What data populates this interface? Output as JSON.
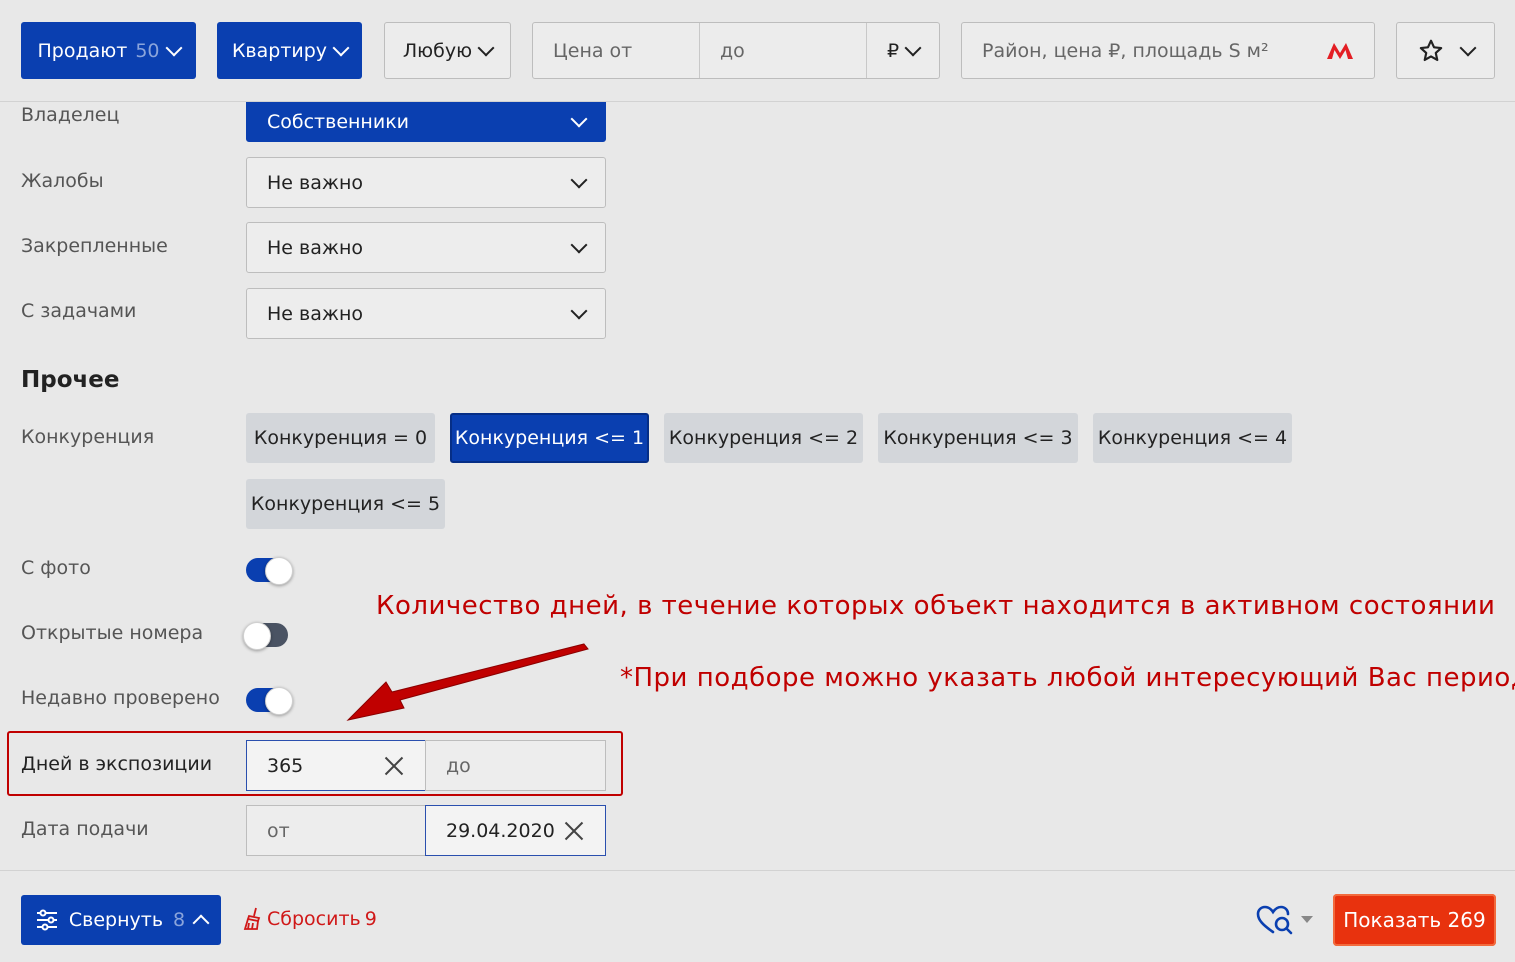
{
  "topbar": {
    "deal": {
      "label": "Продают",
      "count": "50"
    },
    "type": {
      "label": "Квартиру"
    },
    "rooms": {
      "label": "Любую"
    },
    "price": {
      "from_placeholder": "Цена от",
      "to_placeholder": "до",
      "currency": "₽"
    },
    "search": {
      "placeholder": "Район, цена ₽, площадь S м²"
    },
    "icons": [
      "metro-icon",
      "star-icon"
    ]
  },
  "filters": {
    "owner": {
      "label": "Владелец",
      "value": "Собственники"
    },
    "complaints": {
      "label": "Жалобы",
      "value": "Не важно"
    },
    "pinned": {
      "label": "Закрепленные",
      "value": "Не важно"
    },
    "tasks": {
      "label": "С задачами",
      "value": "Не важно"
    }
  },
  "other": {
    "title": "Прочее",
    "competition": {
      "label": "Конкуренция",
      "options": [
        "Конкуренция = 0",
        "Конкуренция <= 1",
        "Конкуренция <= 2",
        "Конкуренция <= 3",
        "Конкуренция <= 4",
        "Конкуренция <= 5"
      ],
      "selected": "Конкуренция <= 1"
    },
    "with_photo": {
      "label": "С фото",
      "on": true
    },
    "open_numbers": {
      "label": "Открытые номера",
      "on": false
    },
    "recently_checked": {
      "label": "Недавно проверено",
      "on": true
    },
    "days_exposure": {
      "label": "Дней в экспозиции",
      "from_value": "365",
      "to_placeholder": "до"
    },
    "submit_date": {
      "label": "Дата подачи",
      "from_placeholder": "от",
      "to_value": "29.04.2020"
    }
  },
  "annotations": {
    "main": "Количество дней, в течение которых объект находится в активном состоянии",
    "note": "*При подборе можно указать любой интересующий Вас период",
    "color": "#c00000"
  },
  "bottombar": {
    "collapse": {
      "label": "Свернуть",
      "count": "8"
    },
    "reset": {
      "label": "Сбросить",
      "count": "9"
    },
    "show": {
      "label": "Показать 269"
    }
  },
  "colors": {
    "primary": "#0a3fb0",
    "accent": "#e8320e",
    "background": "#e8e8e8"
  }
}
